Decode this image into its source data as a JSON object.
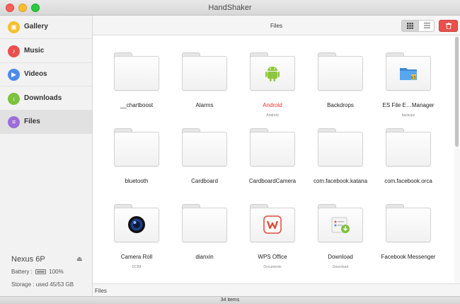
{
  "window": {
    "title": "HandShaker"
  },
  "sidebar": {
    "items": [
      {
        "label": "Gallery",
        "icon": "gallery-icon",
        "color": "#f5c02d",
        "glyph": "▣",
        "active": false
      },
      {
        "label": "Music",
        "icon": "music-note-icon",
        "color": "#e8504d",
        "glyph": "♪",
        "active": false
      },
      {
        "label": "Videos",
        "icon": "play-icon",
        "color": "#4d8be8",
        "glyph": "▶",
        "active": false
      },
      {
        "label": "Downloads",
        "icon": "download-icon",
        "color": "#7cc23c",
        "glyph": "↓",
        "active": false
      },
      {
        "label": "Files",
        "icon": "document-icon",
        "color": "#9b6fd6",
        "glyph": "≡",
        "active": true
      }
    ]
  },
  "device": {
    "name": "Nexus 6P",
    "battery_label": "Battery :",
    "battery_value": "100%",
    "battery_level": 1.0,
    "storage": "Storage : used 45/53 GB"
  },
  "main": {
    "title": "Files",
    "view_modes": {
      "grid_icon": "grid-view-icon",
      "list_icon": "list-view-icon",
      "active": "grid"
    },
    "delete_icon": "trash-icon",
    "path": "Files",
    "status": "34 items"
  },
  "files": [
    {
      "name": "__chartboost",
      "sub": "",
      "overlay": ""
    },
    {
      "name": "Alarms",
      "sub": "",
      "overlay": ""
    },
    {
      "name": "Android",
      "sub": "Android",
      "overlay": "android-icon",
      "highlight": true
    },
    {
      "name": "Backdrops",
      "sub": "",
      "overlay": ""
    },
    {
      "name": "ES File E…Manager",
      "sub": "backups",
      "overlay": "es-file-explorer-icon"
    },
    {
      "name": "bluetooth",
      "sub": "",
      "overlay": ""
    },
    {
      "name": "Cardboard",
      "sub": "",
      "overlay": ""
    },
    {
      "name": "CardboardCamera",
      "sub": "",
      "overlay": ""
    },
    {
      "name": "com.facebook.katana",
      "sub": "",
      "overlay": ""
    },
    {
      "name": "com.facebook.orca",
      "sub": "",
      "overlay": ""
    },
    {
      "name": "Camera Roll",
      "sub": "DCIM",
      "overlay": "camera-lens-icon"
    },
    {
      "name": "dianxin",
      "sub": "",
      "overlay": ""
    },
    {
      "name": "WPS Office",
      "sub": "Documents",
      "overlay": "wps-office-icon"
    },
    {
      "name": "Download",
      "sub": "Download",
      "overlay": "download-folder-icon"
    },
    {
      "name": "Facebook Messenger",
      "sub": "",
      "overlay": ""
    }
  ]
}
